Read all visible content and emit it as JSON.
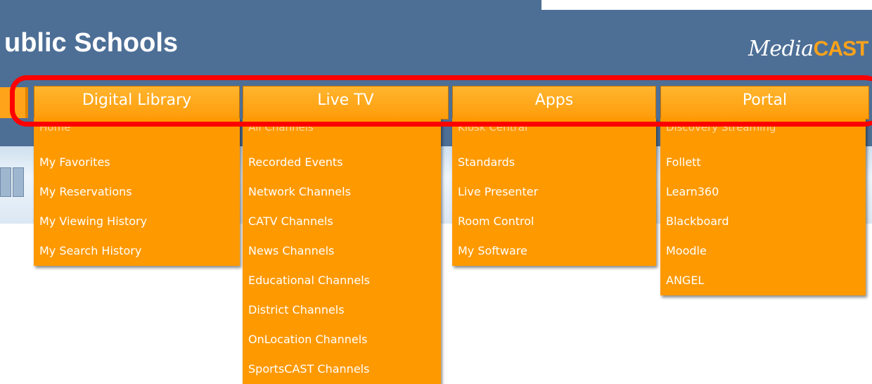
{
  "header": {
    "title": "ublic Schools",
    "logo_media": "Media",
    "logo_cast": "CAST"
  },
  "menu": [
    {
      "label": "Digital Library",
      "items": [
        "Home",
        "My Favorites",
        "My Reservations",
        "My Viewing History",
        "My Search History"
      ]
    },
    {
      "label": "Live TV",
      "items": [
        "All Channels",
        "Recorded Events",
        "Network Channels",
        "CATV Channels",
        "News Channels",
        "Educational Channels",
        "District Channels",
        "OnLocation Channels",
        "SportsCAST Channels"
      ]
    },
    {
      "label": "Apps",
      "items": [
        "Kiosk Central",
        "Standards",
        "Live Presenter",
        "Room Control",
        "My Software"
      ]
    },
    {
      "label": "Portal",
      "items": [
        "Discovery Streaming",
        "Follett",
        "Learn360",
        "Blackboard",
        "Moodle",
        "ANGEL"
      ]
    }
  ],
  "colors": {
    "header_bg": "#4d6f96",
    "menu_orange": "#ff9900",
    "highlight": "#ff0000"
  }
}
